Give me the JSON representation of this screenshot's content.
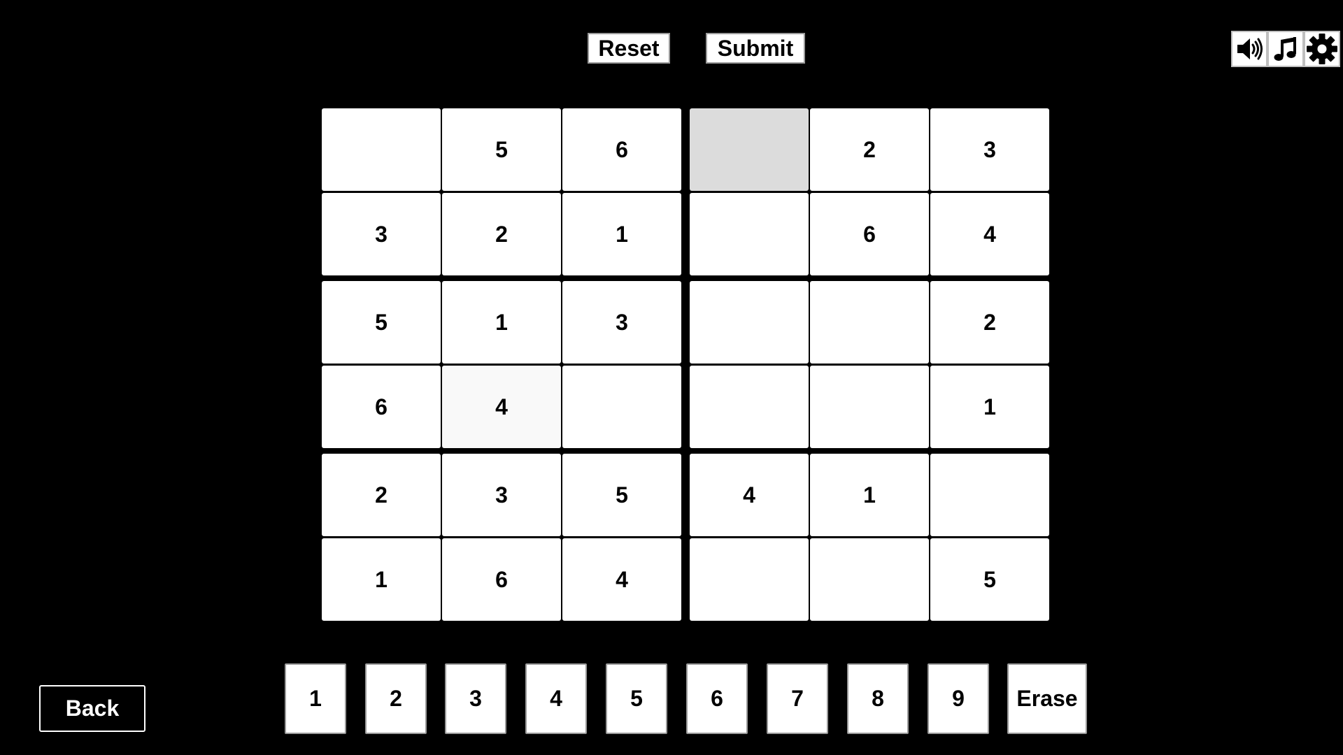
{
  "toolbar": {
    "reset_label": "Reset",
    "submit_label": "Submit"
  },
  "icons": {
    "sound": "speaker-icon",
    "music": "music-note-icon",
    "settings": "gear-icon"
  },
  "board": {
    "size": 6,
    "selected_cell": [
      0,
      3
    ],
    "hovered_cell": [
      3,
      1
    ],
    "cells": [
      [
        "",
        "5",
        "6",
        "",
        "2",
        "3"
      ],
      [
        "3",
        "2",
        "1",
        "",
        "6",
        "4"
      ],
      [
        "5",
        "1",
        "3",
        "",
        "",
        "2"
      ],
      [
        "6",
        "4",
        "",
        "",
        "",
        "1"
      ],
      [
        "2",
        "3",
        "5",
        "4",
        "1",
        ""
      ],
      [
        "1",
        "6",
        "4",
        "",
        "",
        "5"
      ]
    ]
  },
  "keypad": {
    "numbers": [
      "1",
      "2",
      "3",
      "4",
      "5",
      "6",
      "7",
      "8",
      "9"
    ],
    "erase_label": "Erase"
  },
  "nav": {
    "back_label": "Back"
  },
  "colors": {
    "background": "#000000",
    "cell": "#ffffff",
    "selected_cell": "#dcdcdc",
    "text": "#000000"
  }
}
